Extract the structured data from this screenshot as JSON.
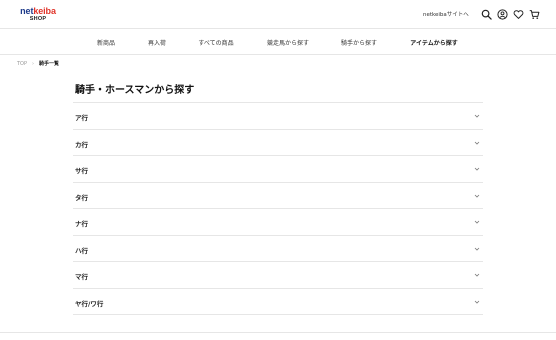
{
  "header": {
    "logo_main_a": "net",
    "logo_main_b": "keiba",
    "logo_sub": "SHOP",
    "site_link": "netkeibaサイトへ",
    "icons": [
      "search-icon",
      "user-icon",
      "heart-icon",
      "cart-icon"
    ]
  },
  "nav": {
    "items": [
      {
        "label": "新商品"
      },
      {
        "label": "再入荷"
      },
      {
        "label": "すべての商品"
      },
      {
        "label": "競走馬から探す"
      },
      {
        "label": "騎手から探す"
      },
      {
        "label": "アイテムから探す"
      }
    ]
  },
  "breadcrumb": {
    "home": "TOP",
    "current": "騎手一覧"
  },
  "page": {
    "title": "騎手・ホースマンから探す",
    "rows": [
      {
        "label": "ア行"
      },
      {
        "label": "カ行"
      },
      {
        "label": "サ行"
      },
      {
        "label": "タ行"
      },
      {
        "label": "ナ行"
      },
      {
        "label": "ハ行"
      },
      {
        "label": "マ行"
      },
      {
        "label": "ヤ行/ワ行"
      }
    ]
  },
  "colors": {
    "logo_blue": "#1d3a8a",
    "logo_red": "#e0352b",
    "divider": "#e6e6e6"
  }
}
